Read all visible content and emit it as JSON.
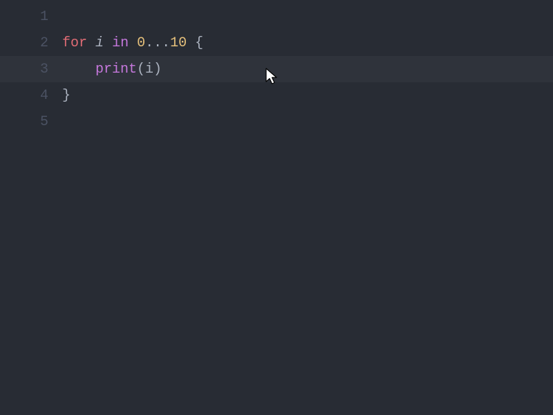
{
  "editor": {
    "highlighted_line": 3,
    "lines": [
      {
        "num": "1",
        "tokens": []
      },
      {
        "num": "2",
        "tokens": [
          {
            "cls": "tok-keyword",
            "text": "for"
          },
          {
            "cls": "tok-punct",
            "text": " "
          },
          {
            "cls": "tok-ident",
            "text": "i"
          },
          {
            "cls": "tok-punct",
            "text": " "
          },
          {
            "cls": "tok-in",
            "text": "in"
          },
          {
            "cls": "tok-punct",
            "text": " "
          },
          {
            "cls": "tok-number",
            "text": "0"
          },
          {
            "cls": "tok-punct",
            "text": "..."
          },
          {
            "cls": "tok-number",
            "text": "10"
          },
          {
            "cls": "tok-punct",
            "text": " {"
          }
        ]
      },
      {
        "num": "3",
        "tokens": [
          {
            "cls": "tok-punct",
            "text": "    "
          },
          {
            "cls": "tok-call",
            "text": "print"
          },
          {
            "cls": "tok-punct",
            "text": "(i)"
          }
        ]
      },
      {
        "num": "4",
        "tokens": [
          {
            "cls": "tok-punct",
            "text": "}"
          }
        ]
      },
      {
        "num": "5",
        "tokens": []
      }
    ]
  }
}
